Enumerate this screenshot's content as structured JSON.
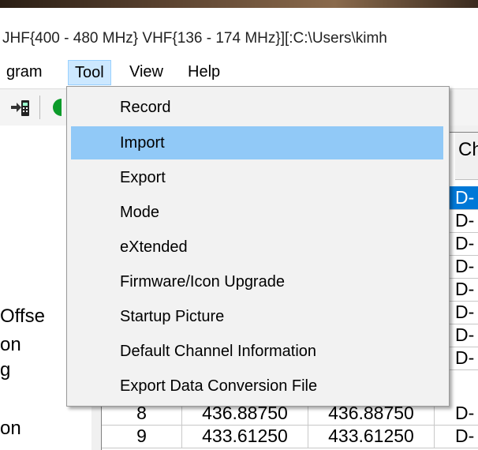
{
  "window": {
    "title": "JHF{400 - 480 MHz} VHF{136 - 174 MHz}][:C:\\Users\\kimh"
  },
  "menubar": {
    "items": [
      {
        "label": "gram"
      },
      {
        "label": "Tool",
        "active": true
      },
      {
        "label": "View"
      },
      {
        "label": "Help"
      }
    ]
  },
  "toolbar": {
    "icons": [
      "write-to-radio-icon",
      "green-status-icon"
    ]
  },
  "left_panel": {
    "labels": [
      "Offse",
      "on",
      "g",
      "on"
    ]
  },
  "tool_menu": {
    "items": [
      {
        "label": "Record"
      },
      {
        "label": "Import",
        "highlighted": true
      },
      {
        "label": "Export"
      },
      {
        "label": "Mode"
      },
      {
        "label": "eXtended"
      },
      {
        "label": "Firmware/Icon Upgrade"
      },
      {
        "label": "Startup Picture"
      },
      {
        "label": "Default Channel Information"
      },
      {
        "label": "Export Data Conversion File"
      }
    ]
  },
  "grid": {
    "header_partial": "Ch",
    "rows": [
      {
        "no": "",
        "rx": "",
        "tx": "",
        "mode": "D-",
        "selected": true
      },
      {
        "no": "",
        "rx": "",
        "tx": "",
        "mode": "D-"
      },
      {
        "no": "",
        "rx": "",
        "tx": "",
        "mode": "D-"
      },
      {
        "no": "",
        "rx": "",
        "tx": "",
        "mode": "D-"
      },
      {
        "no": "",
        "rx": "",
        "tx": "",
        "mode": "D-"
      },
      {
        "no": "",
        "rx": "",
        "tx": "",
        "mode": "D-"
      },
      {
        "no": "",
        "rx": "",
        "tx": "",
        "mode": "D-"
      },
      {
        "no": "",
        "rx": "",
        "tx": "",
        "mode": "D-"
      },
      {
        "no": "8",
        "rx": "436.88750",
        "tx": "436.88750",
        "mode": "D-"
      },
      {
        "no": "9",
        "rx": "433.61250",
        "tx": "433.61250",
        "mode": "D-"
      }
    ]
  },
  "colors": {
    "menu_highlight": "#91c9f7",
    "menubar_active": "#cce8ff",
    "selected_cell": "#0078d7"
  }
}
